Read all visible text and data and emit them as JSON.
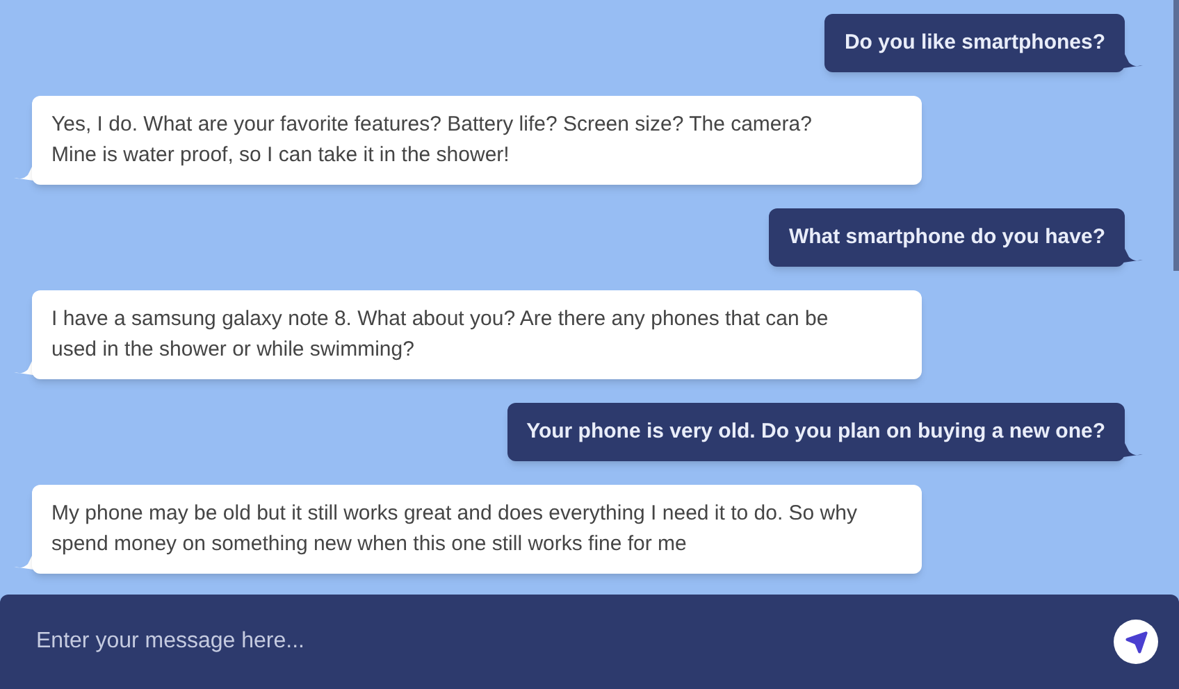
{
  "messages": [
    {
      "kind": "user",
      "text": "Do you like smartphones?"
    },
    {
      "kind": "bot",
      "text": "Yes, I do. What are your favorite features? Battery life? Screen size? The camera? Mine is water proof, so I can take it in the shower!"
    },
    {
      "kind": "user",
      "text": "What smartphone do you have?"
    },
    {
      "kind": "bot",
      "text": "I have a samsung galaxy note 8. What about you? Are there any phones that can be used in the shower or while swimming?"
    },
    {
      "kind": "user",
      "text": "Your phone is very old. Do you plan on buying a new one?"
    },
    {
      "kind": "bot",
      "text": "My phone may be old but it still works great and does everything I need it to do. So why spend money on something new when this one still works fine for me"
    }
  ],
  "composer": {
    "placeholder": "Enter your message here..."
  }
}
